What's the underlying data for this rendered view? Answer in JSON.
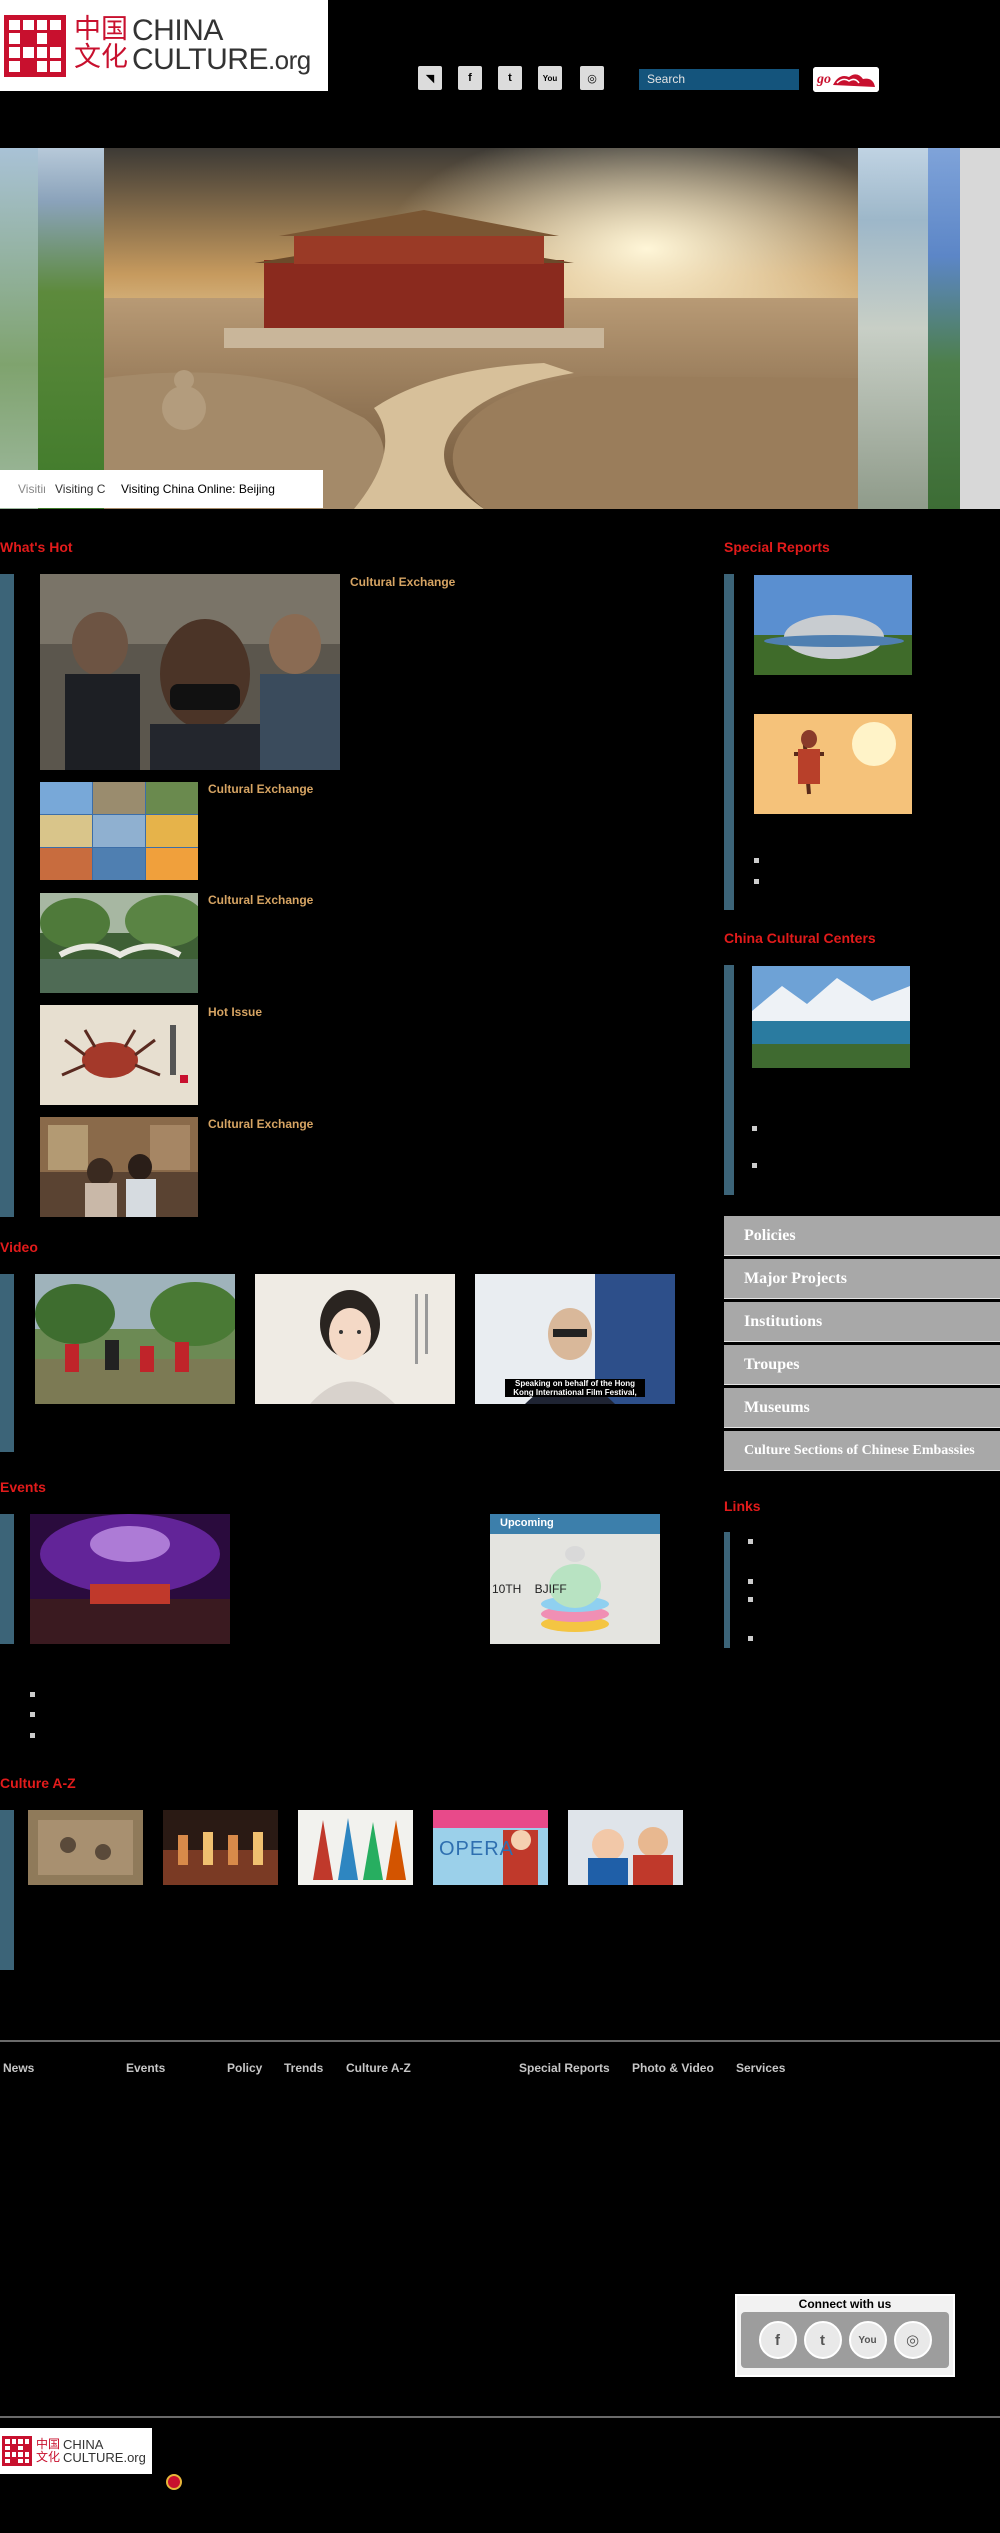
{
  "header": {
    "logo_cn": "中国\n文化",
    "logo_en_line1": "CHINA",
    "logo_en_line2": "CULTURE",
    "logo_en_org": ".org",
    "social": [
      {
        "name": "rss-icon",
        "glyph": "◥"
      },
      {
        "name": "facebook-icon",
        "glyph": "f"
      },
      {
        "name": "twitter-icon",
        "glyph": "t"
      },
      {
        "name": "youtube-icon",
        "glyph": "You"
      },
      {
        "name": "instagram-icon",
        "glyph": "◎"
      }
    ],
    "search_placeholder": "Search",
    "go_label": "go"
  },
  "hero": {
    "captions": [
      "Visitin",
      "Visiting C",
      "Visiting China Online: Beijing"
    ]
  },
  "whats_hot": {
    "title": "What's Hot",
    "items": [
      {
        "tag": "Cultural Exchange"
      },
      {
        "tag": "Cultural Exchange"
      },
      {
        "tag": "Cultural Exchange"
      },
      {
        "tag": "Hot Issue"
      },
      {
        "tag": "Cultural Exchange"
      }
    ]
  },
  "video": {
    "title": "Video"
  },
  "events": {
    "title": "Events",
    "upcoming": "Upcoming",
    "poster_text": "10TH    BJIFF"
  },
  "culture_az": {
    "title": "Culture A-Z",
    "opera_label": "OPERA"
  },
  "sidebar": {
    "special_reports": "Special Reports",
    "cultural_centers": "China Cultural Centers",
    "menu": [
      "Policies",
      "Major Projects",
      "Institutions",
      "Troupes",
      "Museums",
      "Culture Sections of Chinese Embassies"
    ],
    "links": "Links"
  },
  "footer": {
    "links": [
      "News",
      "Events",
      "Policy",
      "Trends",
      "Culture A-Z",
      "Special Reports",
      "Photo & Video",
      "Services"
    ],
    "connect_title": "Connect with us",
    "connect_icons": [
      "f",
      "t",
      "You",
      "◎"
    ]
  },
  "video_caption": "Speaking on behalf of the Hong Kong International Film Festival,",
  "colors": {
    "accent_red": "#e21b1b",
    "tag_gold": "#d6a463",
    "bar_blue": "#3c6478",
    "menu_gray": "#a8a8a8",
    "search_blue": "#14547c"
  }
}
